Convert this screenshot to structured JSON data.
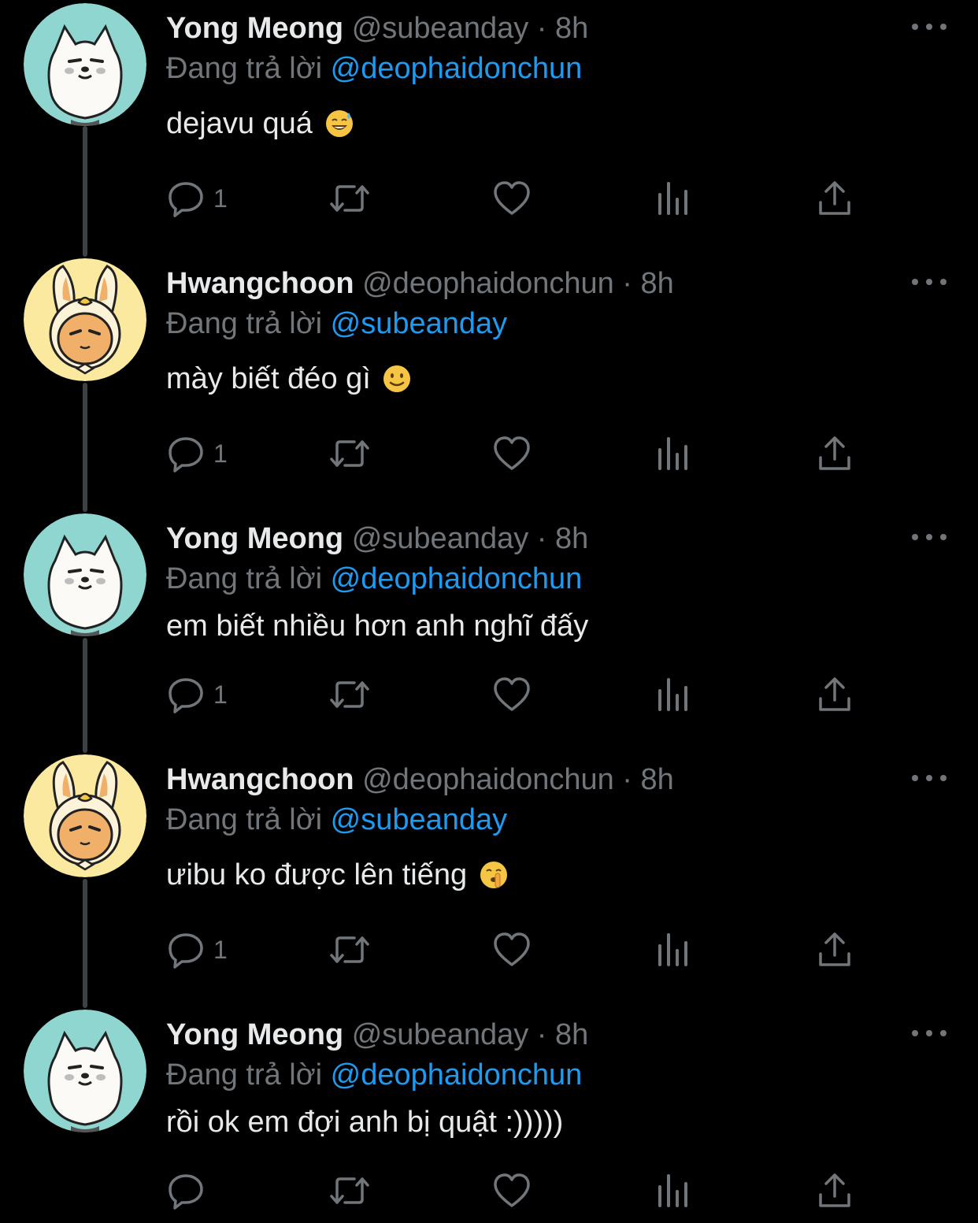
{
  "tweets": [
    {
      "name": "Yong Meong",
      "handle": "@subeanday",
      "separator": "·",
      "time": "8h",
      "reply_prefix": "Đang trả lời",
      "reply_to": "@deophaidonchun",
      "text": "dejavu quá",
      "emoji": "sweat-smile-emoji",
      "reply_count": "1",
      "avatar": "white-dog-avatar"
    },
    {
      "name": "Hwangchoon",
      "handle": "@deophaidonchun",
      "separator": "·",
      "time": "8h",
      "reply_prefix": "Đang trả lời",
      "reply_to": "@subeanday",
      "text": "mày biết đéo gì",
      "emoji": "slight-smile-emoji",
      "reply_count": "1",
      "avatar": "yellow-bunny-avatar"
    },
    {
      "name": "Yong Meong",
      "handle": "@subeanday",
      "separator": "·",
      "time": "8h",
      "reply_prefix": "Đang trả lời",
      "reply_to": "@deophaidonchun",
      "text": "em biết nhiều hơn anh nghĩ đấy",
      "emoji": "",
      "reply_count": "1",
      "avatar": "white-dog-avatar"
    },
    {
      "name": "Hwangchoon",
      "handle": "@deophaidonchun",
      "separator": "·",
      "time": "8h",
      "reply_prefix": "Đang trả lời",
      "reply_to": "@subeanday",
      "text": "ưibu ko được lên tiếng",
      "emoji": "shushing-emoji",
      "reply_count": "1",
      "avatar": "yellow-bunny-avatar"
    },
    {
      "name": "Yong Meong",
      "handle": "@subeanday",
      "separator": "·",
      "time": "8h",
      "reply_prefix": "Đang trả lời",
      "reply_to": "@deophaidonchun",
      "text": "rồi ok em đợi anh bị quật :)))))",
      "emoji": "",
      "reply_count": "",
      "avatar": "white-dog-avatar"
    }
  ],
  "colors": {
    "background": "#000000",
    "text": "#e7e9ea",
    "secondary": "#71767b",
    "link": "#1d9bf0",
    "thread_line": "#3e4144"
  }
}
